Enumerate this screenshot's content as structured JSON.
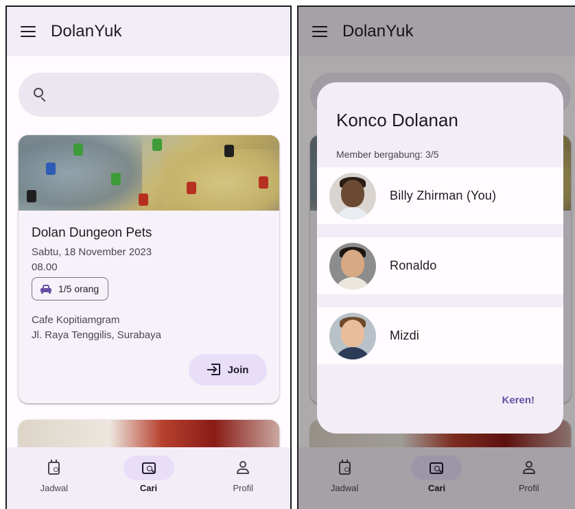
{
  "app": {
    "title": "DolanYuk"
  },
  "search": {
    "placeholder": ""
  },
  "event": {
    "title": "Dolan Dungeon Pets",
    "date": "Sabtu, 18 November 2023",
    "time": "08.00",
    "capacity": "1/5 orang",
    "venue": "Cafe Kopitiamgram",
    "address": "Jl. Raya Tenggilis, Surabaya",
    "join_label": "Join"
  },
  "nav": {
    "items": [
      {
        "label": "Jadwal",
        "icon": "calendar-icon",
        "active": false
      },
      {
        "label": "Cari",
        "icon": "search-chat-icon",
        "active": true
      },
      {
        "label": "Profil",
        "icon": "person-icon",
        "active": false
      }
    ]
  },
  "dialog": {
    "title": "Konco Dolanan",
    "subtitle": "Member bergabung: 3/5",
    "members": [
      {
        "name": "Billy Zhirman (You)"
      },
      {
        "name": "Ronaldo"
      },
      {
        "name": "Mizdi"
      }
    ],
    "action_label": "Keren!"
  },
  "colors": {
    "primary": "#6750a4",
    "surface_container": "#f3edf7",
    "secondary_container": "#e8def8"
  }
}
